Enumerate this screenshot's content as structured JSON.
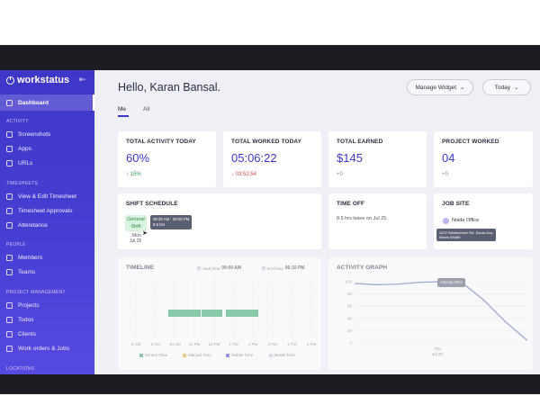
{
  "brand": {
    "name": "workstatus"
  },
  "sidebar": {
    "dashboard": "Dashboard",
    "sections": {
      "activity": "ACTIVITY",
      "timesheets": "TIMESHEETS",
      "people": "PEOPLE",
      "project_management": "PROJECT MANAGEMENT",
      "locations": "LOCATIONS"
    },
    "items": {
      "screenshots": "Screenshots",
      "apps": "Apps",
      "urls": "URLs",
      "view_edit_timesheet": "View & Edit Timesheet",
      "timesheet_approvals": "Timesheet Approvals",
      "attendance": "Attendance",
      "members": "Members",
      "teams": "Teams",
      "projects": "Projects",
      "todos": "Todos",
      "clients": "Clients",
      "work_orders": "Work orders & Jobs"
    }
  },
  "header": {
    "greeting": "Hello, Karan Bansal.",
    "manage_widget": "Manage Widget",
    "today": "Today",
    "tabs": [
      "Me",
      "All"
    ]
  },
  "cards": {
    "total_activity": {
      "title": "TOTAL ACTIVITY TODAY",
      "value": "60%",
      "delta": "↑ 15%"
    },
    "total_worked": {
      "title": "TOTAL WORKED TODAY",
      "value": "05:06:22",
      "delta": "↓ 03:52:54"
    },
    "total_earned": {
      "title": "TOTAL EARNED",
      "value": "$145",
      "delta": "+0"
    },
    "project_worked": {
      "title": "PROJECT WORKED",
      "value": "04",
      "delta": "+0"
    },
    "shift_schedule": {
      "title": "SHIFT SCHEDULE",
      "badge_line1": "General",
      "badge_line2": "Shift",
      "day": "Mon",
      "date": "Jul 25",
      "tooltip_time": "08:30 AM - 05:00 PM",
      "tooltip_hours": "8.5 hrs"
    },
    "time_off": {
      "title": "TIME OFF",
      "text": "8.5 hrs leave on Jul 25."
    },
    "job_site": {
      "title": "JOB SITE",
      "site": "Noida Office",
      "addr1": "1872 Westminster Rd. Santa Ana,",
      "addr2": "Illinois 85486"
    },
    "timeline": {
      "title": "TIMELINE",
      "start_label": "Start time",
      "start_value": "09:00 AM",
      "end_label": "End time",
      "end_value": "06:10 PM",
      "ticks": [
        "8 AM",
        "9 AM",
        "10 AM",
        "11 PM",
        "12 PM",
        "1 PM",
        "2 PM",
        "3 PM",
        "4 PM",
        "5 PM"
      ],
      "legend": [
        "Screen Time",
        "Manual Time",
        "Mobile Time",
        "Break Time"
      ]
    },
    "activity_graph": {
      "title": "ACTIVITY GRAPH",
      "tooltip": "Activity 20%",
      "xlabel_day": "Thu",
      "xlabel_date": "Jul 20"
    }
  },
  "chart_data": {
    "type": "line",
    "title": "ACTIVITY GRAPH",
    "xlabel": "",
    "ylabel": "",
    "ylim": [
      0,
      100
    ],
    "yticks": [
      0,
      20,
      40,
      60,
      80,
      100
    ],
    "x": [
      0,
      1,
      2,
      3,
      4,
      5,
      6,
      7,
      8
    ],
    "values": [
      97,
      95,
      96,
      99,
      100,
      98,
      70,
      35,
      5
    ],
    "grid": true
  },
  "colors": {
    "accent": "#3f36c8",
    "positive": "#2c9a55",
    "negative": "#d84b4b",
    "screen_time": "#35a86a",
    "manual_time": "#f0a23b",
    "mobile_time": "#4b47c9",
    "break_time": "#c4c7d1"
  }
}
